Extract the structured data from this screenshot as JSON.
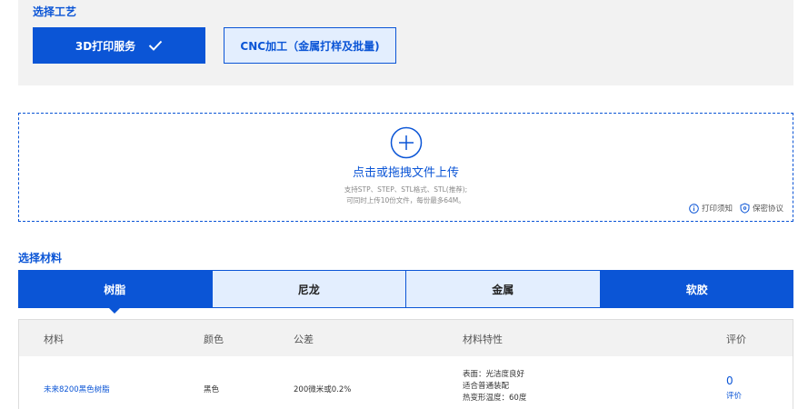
{
  "process": {
    "title": "选择工艺",
    "options": [
      {
        "label": "3D打印服务",
        "selected": true
      },
      {
        "label": "CNC加工（金属打样及批量)",
        "selected": false
      }
    ]
  },
  "upload": {
    "title": "点击或拖拽文件上传",
    "hint_formats": "支持STP、STEP、STL格式、STL(推荐);",
    "hint_limits": "可同时上传10份文件，每份最多64M。",
    "print_notice": "打印须知",
    "privacy": "保密协议",
    "icons": {
      "upload": "plus-circle-icon",
      "notice": "info-icon",
      "privacy": "shield-icon"
    }
  },
  "material": {
    "title": "选择材料",
    "tabs": [
      "树脂",
      "尼龙",
      "金属",
      "软胶"
    ]
  },
  "table": {
    "headers": [
      "材料",
      "颜色",
      "公差",
      "材料特性",
      "评价"
    ],
    "rows": [
      {
        "name": "未来8200黑色树脂",
        "color": "黑色",
        "tolerance": "200微米或0.2%",
        "features": [
          "表面：光洁度良好",
          "适合普通装配",
          "热变形温度：60度"
        ],
        "rating": "0",
        "rating_label": "评价"
      }
    ]
  },
  "colors": {
    "accent": "#0b55d6",
    "light": "#e3eefe",
    "panel": "#f2f2f2"
  }
}
